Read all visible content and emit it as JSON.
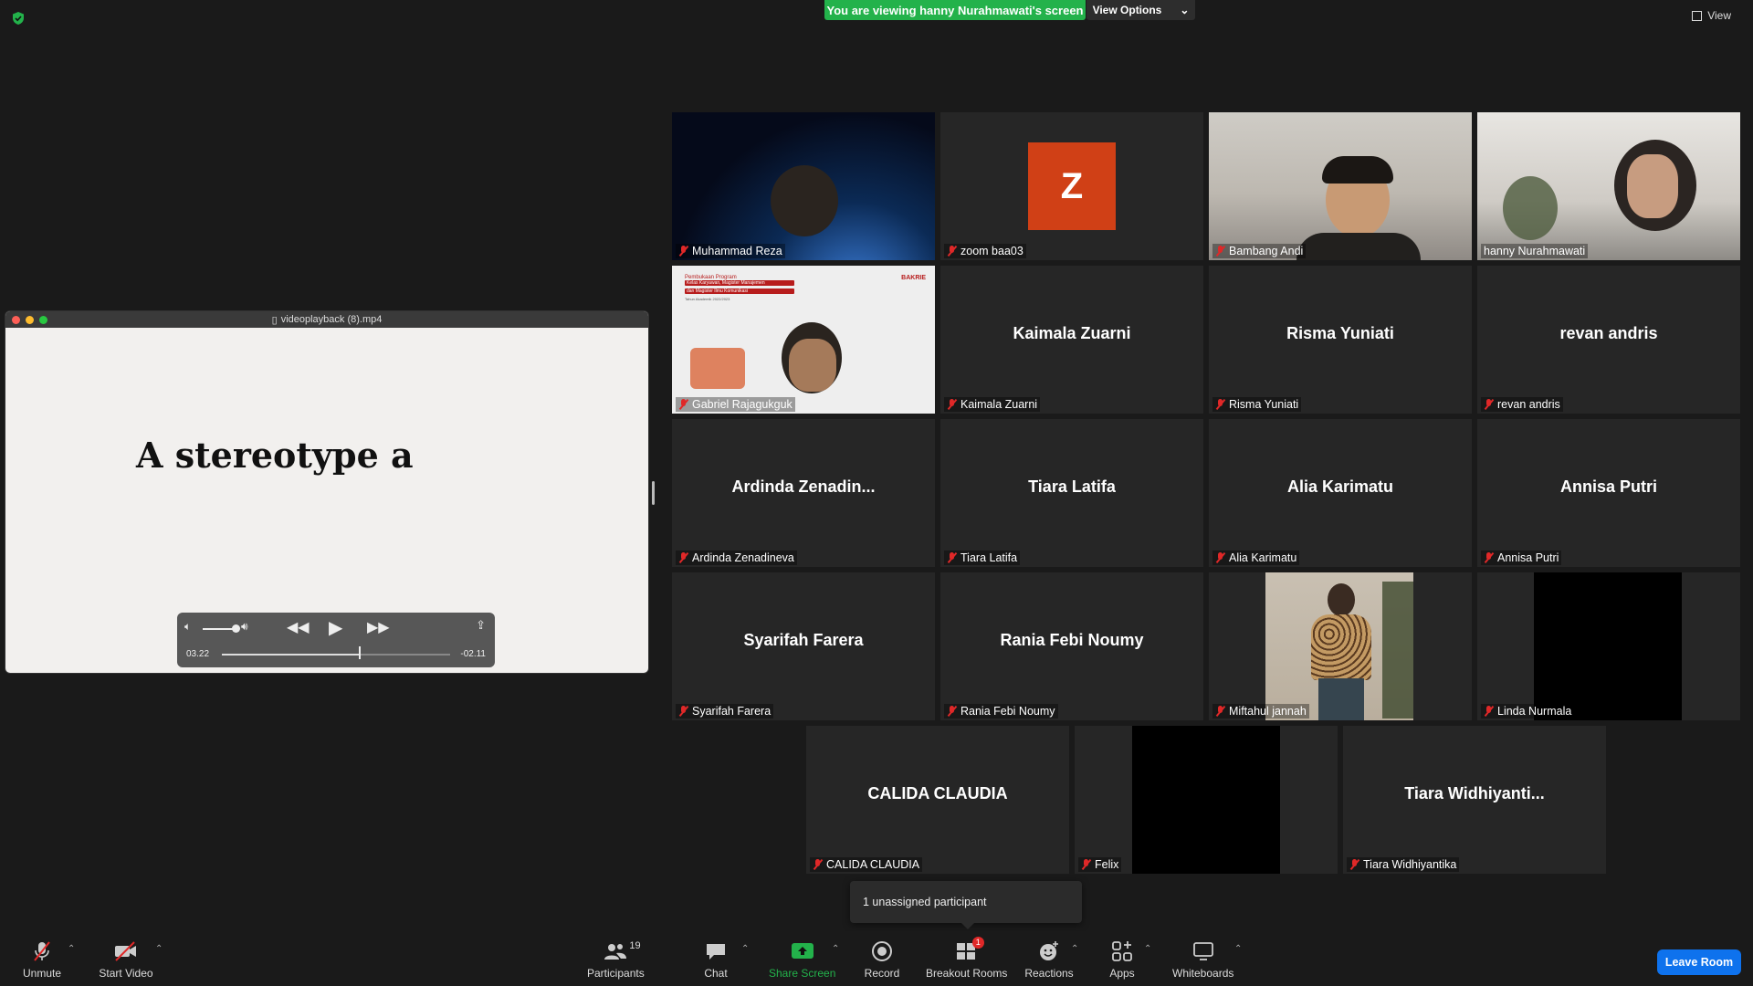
{
  "top_bar": {
    "viewing_banner": "You are viewing hanny Nurahmawati's screen",
    "view_options": "View Options",
    "view": "View"
  },
  "player": {
    "title": "videoplayback (8).mp4",
    "slide_text": "A stereotype a",
    "time_elapsed": "03.22",
    "time_remaining": "-02.11",
    "progress": 0.6,
    "volume": 0.85
  },
  "gabriel_slide": {
    "line1": "Pembukaan Program",
    "line2": "Kelas Karyawan, Magister Manajemen",
    "line3": "dan Magister Ilmu Komunikasi",
    "line4": "Tahun Akademik 2022/2023",
    "logo": "BAKRIE"
  },
  "tiles": [
    {
      "name": "Muhammad Reza"
    },
    {
      "name": "zoom baa03",
      "avatar": "Z"
    },
    {
      "name": "Bambang Andi"
    },
    {
      "name": "hanny Nurahmawati"
    },
    {
      "name": "Gabriel Rajagukguk"
    },
    {
      "name": "Kaimala Zuarni",
      "display": "Kaimala Zuarni"
    },
    {
      "name": "Risma Yuniati",
      "display": "Risma Yuniati"
    },
    {
      "name": "revan andris",
      "display": "revan andris"
    },
    {
      "name": "Ardinda Zenadineva",
      "display": "Ardinda  Zenadin..."
    },
    {
      "name": "Tiara Latifa",
      "display": "Tiara Latifa"
    },
    {
      "name": "Alia Karimatu",
      "display": "Alia Karimatu"
    },
    {
      "name": "Annisa Putri",
      "display": "Annisa Putri"
    },
    {
      "name": "Syarifah Farera",
      "display": "Syarifah Farera"
    },
    {
      "name": "Rania Febi Noumy",
      "display": "Rania Febi Noumy"
    },
    {
      "name": "Miftahul jannah"
    },
    {
      "name": "Linda Nurmala"
    },
    {
      "name": "CALIDA CLAUDIA",
      "display": "CALIDA CLAUDIA"
    },
    {
      "name": "Felix"
    },
    {
      "name": "Tiara Widhiyantika",
      "display": "Tiara  Widhiyanti..."
    }
  ],
  "popup": {
    "text": "1 unassigned participant"
  },
  "toolbar": {
    "unmute": "Unmute",
    "start_video": "Start Video",
    "participants": "Participants",
    "participants_count": "19",
    "chat": "Chat",
    "share_screen": "Share Screen",
    "record": "Record",
    "breakout_rooms": "Breakout Rooms",
    "breakout_badge": "1",
    "reactions": "Reactions",
    "apps": "Apps",
    "whiteboards": "Whiteboards",
    "leave_room": "Leave Room"
  },
  "colors": {
    "banner_green": "#23b24b",
    "leave_blue": "#0e72ed",
    "active_speaker": "#d8f06a",
    "muted_red": "#e02828"
  }
}
